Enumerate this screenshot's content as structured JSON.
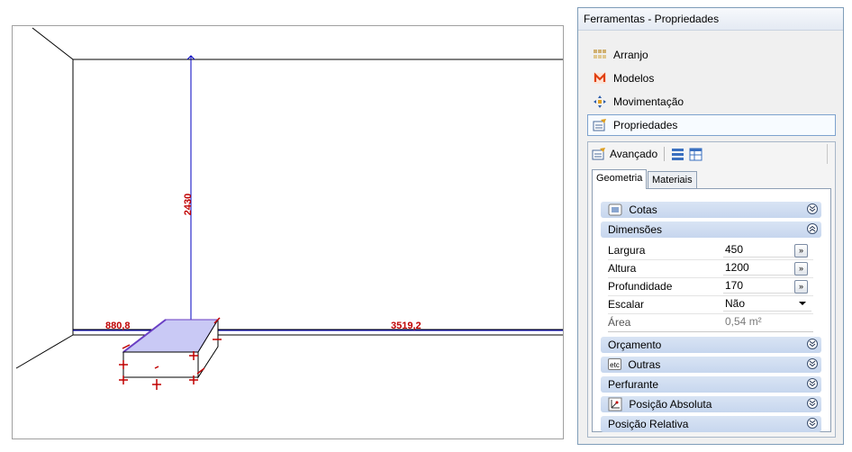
{
  "viewport": {
    "dimensions": {
      "height": "2430",
      "left_width": "880,8",
      "right_width": "3519,2"
    },
    "colors": {
      "dimension": "#c00000",
      "dimension_line": "#0000c0",
      "object_fill": "#c9c9f5",
      "handles": "#c00000"
    }
  },
  "panel": {
    "title": "Ferramentas - Propriedades",
    "nav_items": [
      {
        "label": "Arranjo",
        "icon": "arrangement-grid-icon"
      },
      {
        "label": "Modelos",
        "icon": "models-m-icon"
      },
      {
        "label": "Movimentação",
        "icon": "move-arrows-icon"
      },
      {
        "label": "Propriedades",
        "icon": "properties-icon",
        "active": true
      }
    ],
    "toolbar": {
      "advanced_label": "Avançado"
    },
    "tabs": [
      "Geometria",
      "Materiais"
    ],
    "sections": {
      "cotas": "Cotas",
      "dimensoes": "Dimensões",
      "orcamento": "Orçamento",
      "outras": "Outras",
      "perfurante": "Perfurante",
      "posicao_absoluta": "Posição Absoluta",
      "posicao_relativa": "Posição Relativa"
    },
    "outras_badge": "etc",
    "more_button_label": "»",
    "properties": [
      {
        "label": "Largura",
        "value": "450"
      },
      {
        "label": "Altura",
        "value": "1200"
      },
      {
        "label": "Profundidade",
        "value": "170"
      },
      {
        "label": "Escalar",
        "value": "Não"
      },
      {
        "label": "Área",
        "value": "0,54 m²"
      }
    ]
  }
}
